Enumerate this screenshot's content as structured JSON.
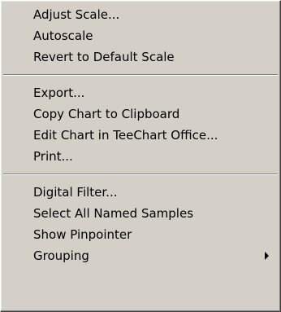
{
  "menu": {
    "groups": [
      {
        "items": [
          {
            "label": "Adjust Scale..."
          },
          {
            "label": "Autoscale"
          },
          {
            "label": "Revert to Default Scale"
          }
        ]
      },
      {
        "items": [
          {
            "label": "Export..."
          },
          {
            "label": "Copy Chart to Clipboard"
          },
          {
            "label": "Edit Chart in TeeChart Office..."
          },
          {
            "label": "Print..."
          }
        ]
      },
      {
        "items": [
          {
            "label": "Digital Filter..."
          },
          {
            "label": "Select All Named Samples"
          },
          {
            "label": "Show Pinpointer"
          },
          {
            "label": "Grouping",
            "submenu_icon": "submenu-arrow-icon"
          }
        ]
      }
    ]
  }
}
